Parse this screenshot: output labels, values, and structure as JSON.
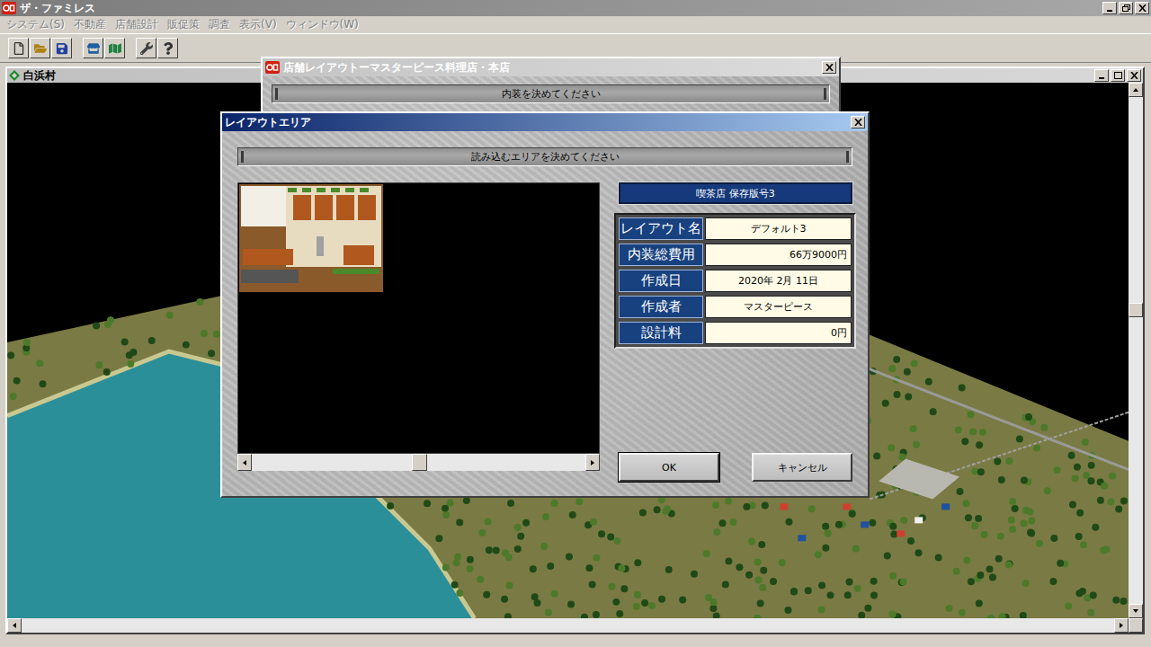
{
  "app": {
    "title": "ザ・ファミレス"
  },
  "menu": [
    {
      "label": "システム(S)",
      "disabled": true
    },
    {
      "label": "不動産",
      "disabled": true
    },
    {
      "label": "店舗設計",
      "disabled": true
    },
    {
      "label": "販促策",
      "disabled": true
    },
    {
      "label": "調査",
      "disabled": true
    },
    {
      "label": "表示(V)",
      "disabled": true
    },
    {
      "label": "ウィンドウ(W)",
      "disabled": true
    }
  ],
  "map_window": {
    "title": "白浜村",
    "v_scroll_level": 0.42
  },
  "layout_dialog": {
    "title": "店舗レイアウトーマスターピース料理店・本店",
    "banner": "内装を決めてください"
  },
  "area_dialog": {
    "title": "レイアウトエリア",
    "banner": "読み込むエリアを決めてください",
    "preview_scroll_level": 0.5,
    "header": "喫茶店 保存版号3",
    "fields": [
      {
        "label": "レイアウト名",
        "value": "デフォルト3",
        "kind": "text"
      },
      {
        "label": "内装総費用",
        "value": "66万9000円",
        "kind": "money"
      },
      {
        "label": "作成日",
        "value": "2020年 2月 11日",
        "kind": "text"
      },
      {
        "label": "作成者",
        "value": "マスターピース",
        "kind": "text"
      },
      {
        "label": "設計料",
        "value": "0円",
        "kind": "money"
      }
    ],
    "buttons": [
      {
        "label": "OK",
        "selected": true
      },
      {
        "label": "キャンセル",
        "selected": false
      }
    ]
  }
}
